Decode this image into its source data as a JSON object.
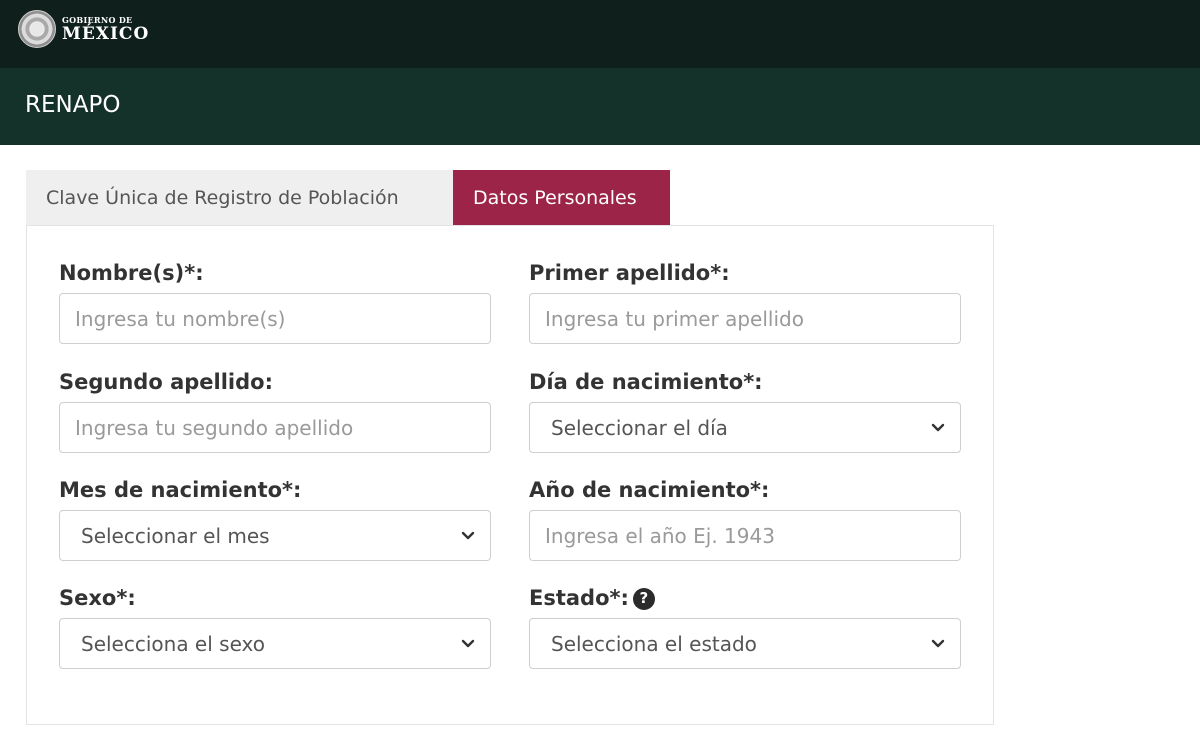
{
  "header": {
    "logo_small": "GOBIERNO DE",
    "logo_big": "MÉXICO",
    "app_title": "RENAPO"
  },
  "tabs": [
    {
      "label": "Clave Única de Registro de Población",
      "active": false
    },
    {
      "label": "Datos Personales",
      "active": true
    }
  ],
  "form": {
    "nombre": {
      "label": "Nombre(s)*:",
      "placeholder": "Ingresa tu nombre(s)"
    },
    "primer_apellido": {
      "label": "Primer apellido*:",
      "placeholder": "Ingresa tu primer apellido"
    },
    "segundo_apellido": {
      "label": "Segundo apellido:",
      "placeholder": "Ingresa tu segundo apellido"
    },
    "dia": {
      "label": "Día de nacimiento*:",
      "value": "Seleccionar el día"
    },
    "mes": {
      "label": "Mes de nacimiento*:",
      "value": "Seleccionar el mes"
    },
    "anio": {
      "label": "Año de nacimiento*:",
      "placeholder": "Ingresa el año Ej. 1943"
    },
    "sexo": {
      "label": "Sexo*:",
      "value": "Selecciona el sexo"
    },
    "estado": {
      "label": "Estado*:",
      "value": "Selecciona el estado",
      "help_icon": "question-circle-icon"
    }
  },
  "colors": {
    "topbar": "#0f1f1b",
    "subbar": "#14312a",
    "accent": "#9d2449"
  }
}
